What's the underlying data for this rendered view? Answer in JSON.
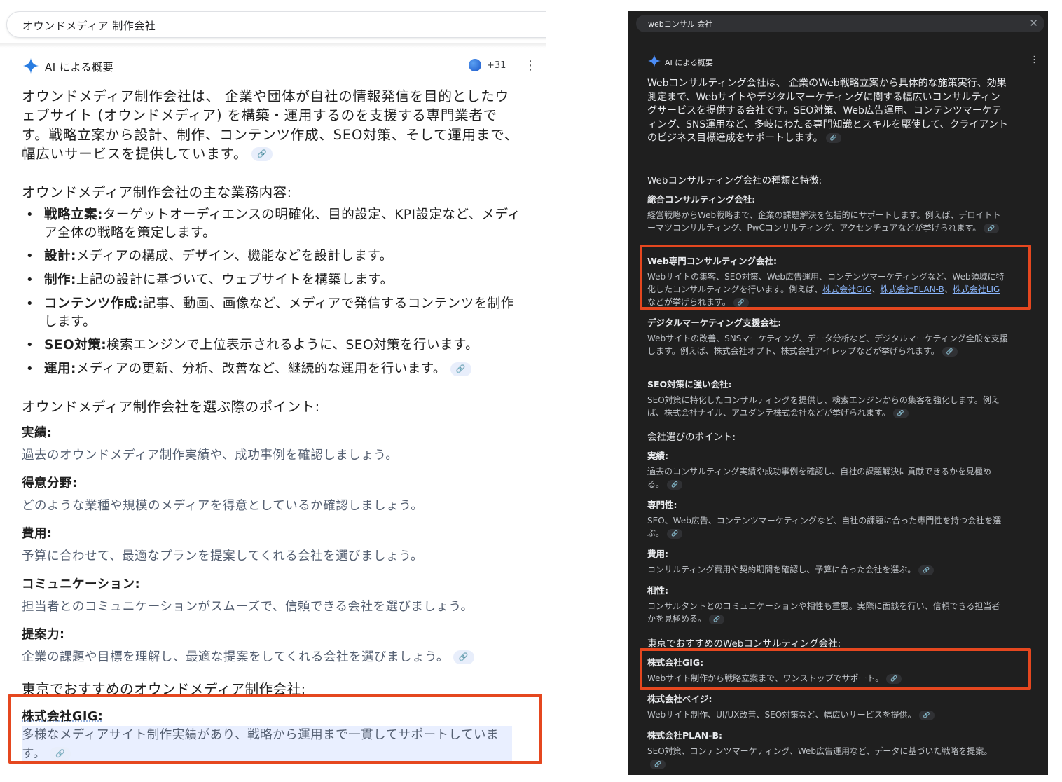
{
  "left": {
    "search_query": "オウンドメディア 制作会社",
    "ai_label": "AI による概要",
    "source_count": "+31",
    "intro": "オウンドメディア制作会社は、 企業や団体が自社の情報発信を目的としたウェブサイト (オウンドメディア) を構築・運用するのを支援する専門業者です。戦略立案から設計、制作、コンテンツ作成、SEO対策、そして運用まで、幅広いサービスを提供しています。",
    "duties_heading": "オウンドメディア制作会社の主な業務内容:",
    "duties": [
      {
        "title": "戦略立案:",
        "text": "ターゲットオーディエンスの明確化、目的設定、KPI設定など、メディア全体の戦略を策定します。"
      },
      {
        "title": "設計:",
        "text": "メディアの構成、デザイン、機能などを設計します。"
      },
      {
        "title": "制作:",
        "text": "上記の設計に基づいて、ウェブサイトを構築します。"
      },
      {
        "title": "コンテンツ作成:",
        "text": "記事、動画、画像など、メディアで発信するコンテンツを制作します。"
      },
      {
        "title": "SEO対策:",
        "text": "検索エンジンで上位表示されるように、SEO対策を行います。"
      },
      {
        "title": "運用:",
        "text": "メディアの更新、分析、改善など、継続的な運用を行います。"
      }
    ],
    "points_heading": "オウンドメディア制作会社を選ぶ際のポイント:",
    "points": [
      {
        "title": "実績:",
        "text": "過去のオウンドメディア制作実績や、成功事例を確認しましょう。"
      },
      {
        "title": "得意分野:",
        "text": "どのような業種や規模のメディアを得意としているか確認しましょう。"
      },
      {
        "title": "費用:",
        "text": "予算に合わせて、最適なプランを提案してくれる会社を選びましょう。"
      },
      {
        "title": "コミュニケーション:",
        "text": "担当者とのコミュニケーションがスムーズで、信頼できる会社を選びましょう。"
      },
      {
        "title": "提案力:",
        "text": "企業の課題や目標を理解し、最適な提案をしてくれる会社を選びましょう。"
      }
    ],
    "tokyo_heading": "東京でおすすめのオウンドメディア制作会社:",
    "gig_title": "株式会社GIG:",
    "gig_text": "多様なメディアサイト制作実績があり、戦略から運用まで一貫してサポートしています。"
  },
  "right": {
    "search_query": "webコンサル 会社",
    "ai_label": "AI による概要",
    "intro": "Webコンサルティング会社は、 企業のWeb戦略立案から具体的な施策実行、効果測定まで、Webサイトやデジタルマーケティングに関する幅広いコンサルティングサービスを提供する会社です。SEO対策、Web広告運用、コンテンツマーケティング、SNS運用など、多岐にわたる専門知識とスキルを駆使して、クライアントのビジネス目標達成をサポートします。",
    "types_heading": "Webコンサルティング会社の種類と特徴:",
    "types": [
      {
        "title": "総合コンサルティング会社:",
        "text": "経営戦略からWeb戦略まで、企業の課題解決を包括的にサポートします。例えば、デロイトトーマツコンサルティング、PwCコンサルティング、アクセンチュアなどが挙げられます。"
      },
      {
        "title": "Web専門コンサルティング会社:",
        "text_before": "Webサイトの集客、SEO対策、Web広告運用、コンテンツマーケティングなど、Web領域に特化したコンサルティングを行います。例えば、",
        "link1": "株式会社GIG",
        "sep1": "、",
        "link2": "株式会社PLAN-B",
        "sep2": "、",
        "link3": "株式会社LIG",
        "text_after": "などが挙げられます。"
      },
      {
        "title": "デジタルマーケティング支援会社:",
        "text": "Webサイトの改善、SNSマーケティング、データ分析など、デジタルマーケティング全般を支援します。例えば、株式会社オプト、株式会社アイレップなどが挙げられます。"
      },
      {
        "title": "SEO対策に強い会社:",
        "text": "SEO対策に特化したコンサルティングを提供し、検索エンジンからの集客を強化します。例えば、株式会社ナイル、アユダンテ株式会社などが挙げられます。"
      }
    ],
    "points_heading": "会社選びのポイント:",
    "points": [
      {
        "title": "実績:",
        "text": "過去のコンサルティング実績や成功事例を確認し、自社の課題解決に貢献できるかを見極める。"
      },
      {
        "title": "専門性:",
        "text": "SEO、Web広告、コンテンツマーケティングなど、自社の課題に合った専門性を持つ会社を選ぶ。"
      },
      {
        "title": "費用:",
        "text": "コンサルティング費用や契約期間を確認し、予算に合った会社を選ぶ。"
      },
      {
        "title": "相性:",
        "text": "コンサルタントとのコミュニケーションや相性も重要。実際に面談を行い、信頼できる担当者かを見極める。"
      }
    ],
    "tokyo_heading": "東京でおすすめのWebコンサルティング会社:",
    "companies": [
      {
        "title": "株式会社GIG:",
        "text": "Webサイト制作から戦略立案まで、ワンストップでサポート。"
      },
      {
        "title": "株式会社ベイジ:",
        "text": "Webサイト制作、UI/UX改善、SEO対策など、幅広いサービスを提供。"
      },
      {
        "title": "株式会社PLAN-B:",
        "text": "SEO対策、コンテンツマーケティング、Web広告運用など、データに基づいた戦略を提案。"
      }
    ]
  },
  "colors": {
    "highlight": "#e5471f",
    "dark_bg": "#1f1f1f",
    "link": "#8ab4f8"
  },
  "icons": {
    "spark": "gemini-spark-icon",
    "link": "link-chip-icon",
    "more": "more-vert-icon",
    "close": "close-icon"
  }
}
